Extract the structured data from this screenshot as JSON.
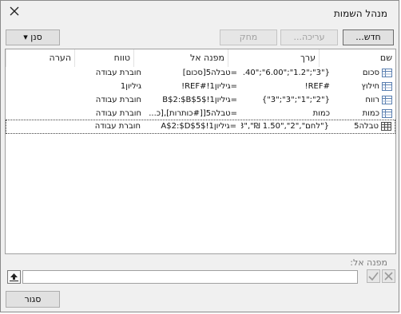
{
  "dialog": {
    "title": "מנהל השמות"
  },
  "toolbar": {
    "new_label": "חדש...",
    "edit_label": "עריכה...",
    "delete_label": "מחק",
    "filter_label": "סנן ▾"
  },
  "table": {
    "headers": {
      "name": "שם",
      "value": "ערך",
      "refers_to": "מפנה אל",
      "scope": "טווח",
      "comment": "הערה"
    },
    "rows": [
      {
        "name": "סכום",
        "value": "{\"3\";\"1.2\";\"6.00\";\"5.40\"}",
        "refers_to": "=טבלה5[סכום]",
        "scope": "חוברת עבודה",
        "comment": ""
      },
      {
        "name": "חילוץ",
        "value": "#REF!",
        "refers_to": "=גיליון1!#REF!",
        "scope": "גיליון1",
        "comment": ""
      },
      {
        "name": "רווח",
        "value": "{\"2\";\"1\";\"3\";\"3\"}",
        "refers_to": "=גיליון1!$B$2:$B$5",
        "scope": "חוברת עבודה",
        "comment": ""
      },
      {
        "name": "כמות",
        "value": "כמות",
        "refers_to": "=טבלה5[[#כותרות],[כ...",
        "scope": "חוברת עבודה",
        "comment": ""
      },
      {
        "name": "טבלה5",
        "value": "{\"לחם\",\"2\",\"1.50 ₪\",\"3\",\"...",
        "refers_to": "=גיליון1!$A$2:$D$5",
        "scope": "חוברת עבודה",
        "comment": ""
      }
    ]
  },
  "refers_to_field": {
    "label": "מפנה אל:",
    "value": ""
  },
  "footer": {
    "close_label": "סגור"
  }
}
